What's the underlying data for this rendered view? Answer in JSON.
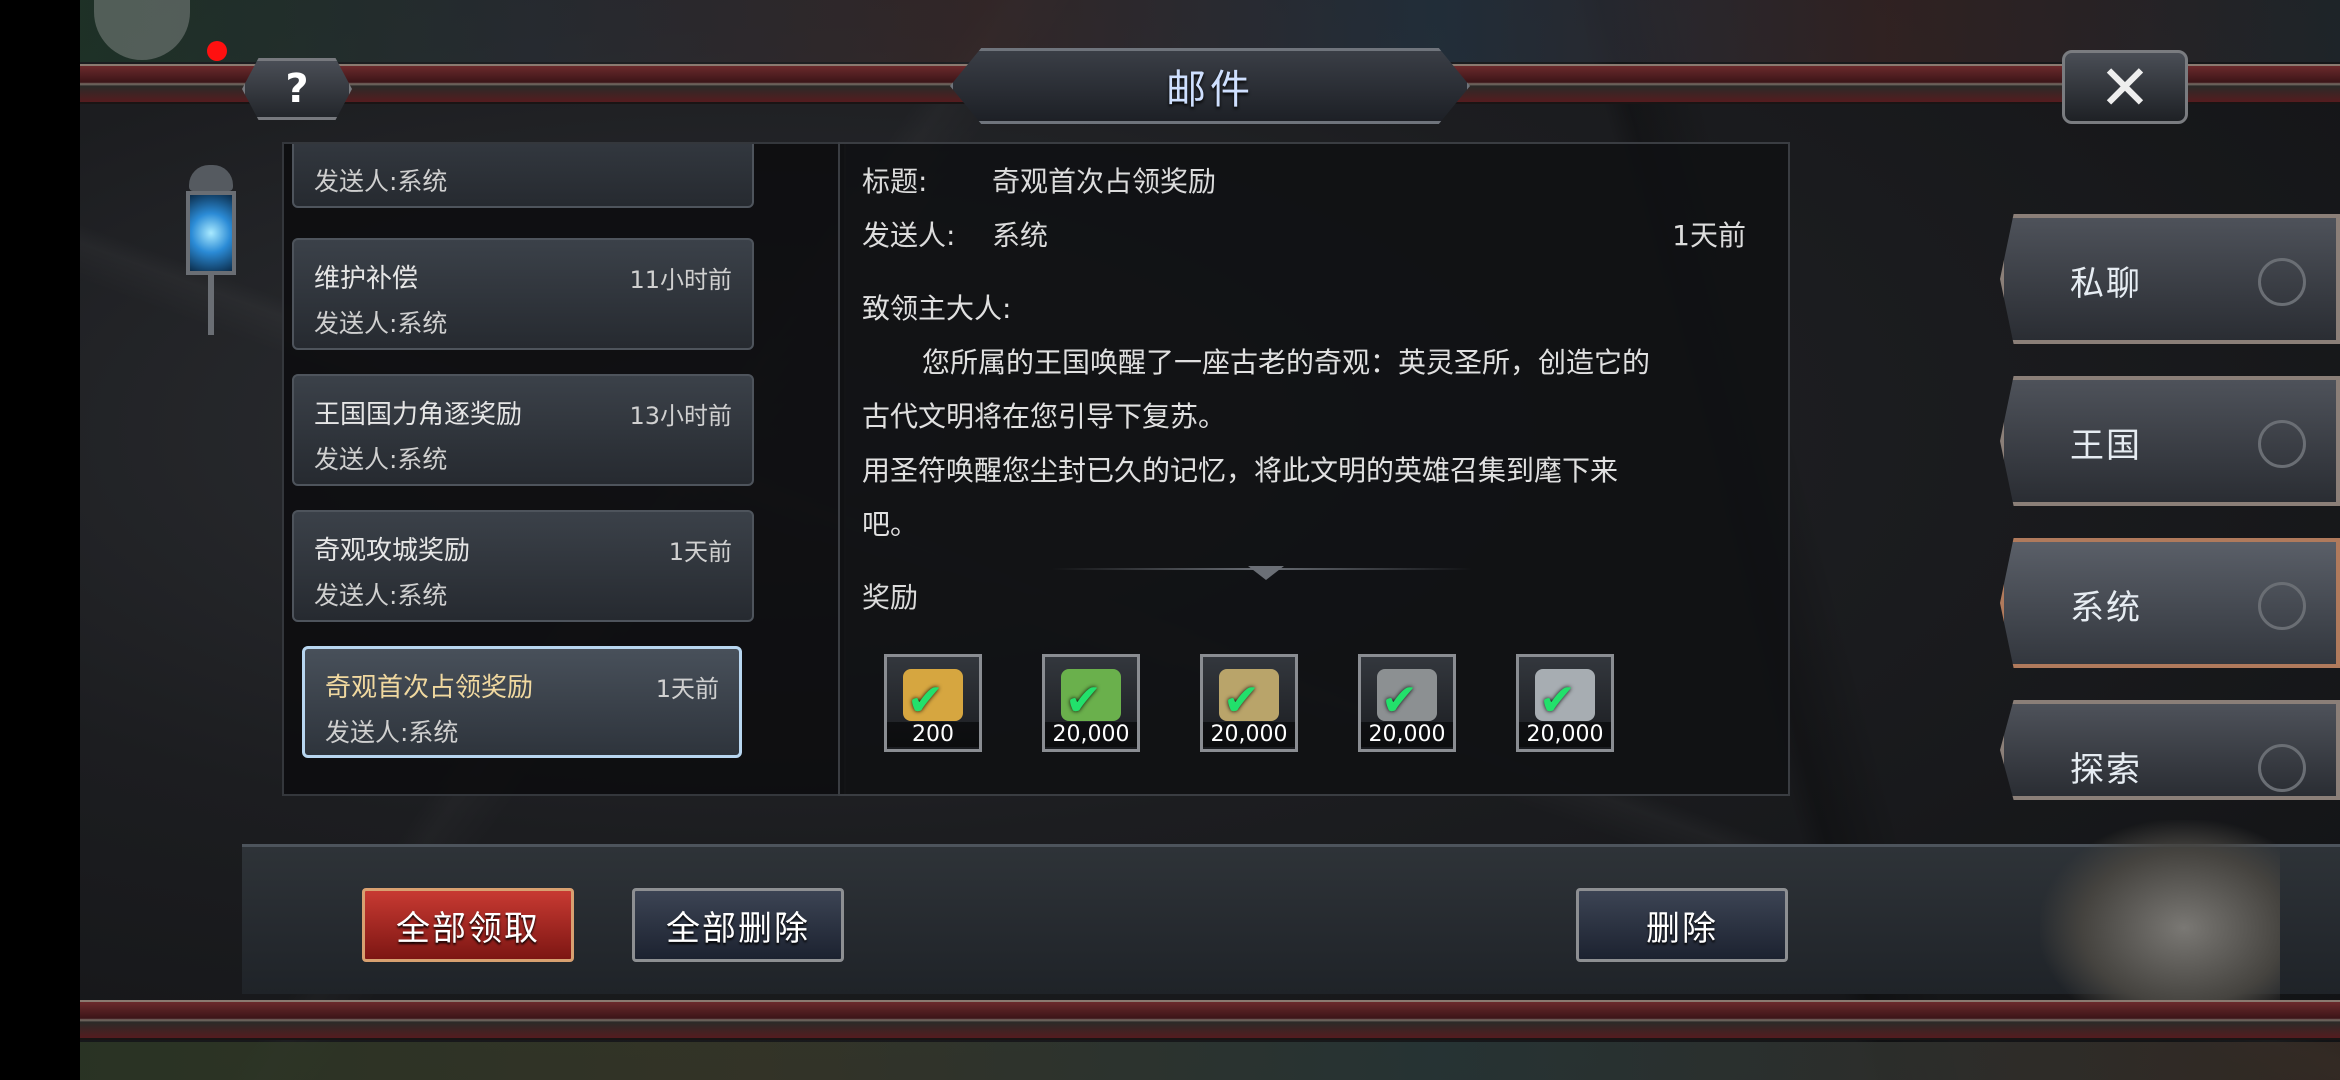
{
  "window": {
    "title": "邮件"
  },
  "header": {
    "help_label": "?",
    "close_label": "✕"
  },
  "mail_list": [
    {
      "subject": "",
      "time": "",
      "sender": "发送人:系统",
      "selected": false
    },
    {
      "subject": "维护补偿",
      "time": "11小时前",
      "sender": "发送人:系统",
      "selected": false
    },
    {
      "subject": "王国国力角逐奖励",
      "time": "13小时前",
      "sender": "发送人:系统",
      "selected": false
    },
    {
      "subject": "奇观攻城奖励",
      "time": "1天前",
      "sender": "发送人:系统",
      "selected": false
    },
    {
      "subject": "奇观首次占领奖励",
      "time": "1天前",
      "sender": "发送人:系统",
      "selected": true
    }
  ],
  "detail": {
    "title_label": "标题:",
    "title_value": "奇观首次占领奖励",
    "sender_label": "发送人:",
    "sender_value": "系统",
    "time": "1天前",
    "greeting": "致领主大人:",
    "para1_line1": "您所属的王国唤醒了一座古老的奇观：英灵圣所，创造它的",
    "para1_line2": "古代文明将在您引导下复苏。",
    "para2_line1": "用圣符唤醒您尘封已久的记忆，将此文明的英雄召集到麾下来",
    "para2_line2": "吧。",
    "rewards_label": "奖励",
    "rewards": [
      {
        "icon": "gold-feather-icon",
        "qty": "200",
        "color": "#d6a640"
      },
      {
        "icon": "green-feather-icon",
        "qty": "20,000",
        "color": "#6ab04c"
      },
      {
        "icon": "wood-log-icon",
        "qty": "20,000",
        "color": "#b9a46a"
      },
      {
        "icon": "stone-icon",
        "qty": "20,000",
        "color": "#8c9092"
      },
      {
        "icon": "iron-ingot-icon",
        "qty": "20,000",
        "color": "#a7adb2"
      }
    ]
  },
  "side_tabs": [
    {
      "label": "私聊",
      "active": false
    },
    {
      "label": "王国",
      "active": false
    },
    {
      "label": "系统",
      "active": true
    },
    {
      "label": "探索",
      "active": false
    }
  ],
  "actions": {
    "claim_all": "全部领取",
    "delete_all": "全部删除",
    "delete": "删除"
  },
  "colors": {
    "claim_button": "#b0302a",
    "selected_border": "#b8d6f0",
    "check": "#22e06b"
  }
}
